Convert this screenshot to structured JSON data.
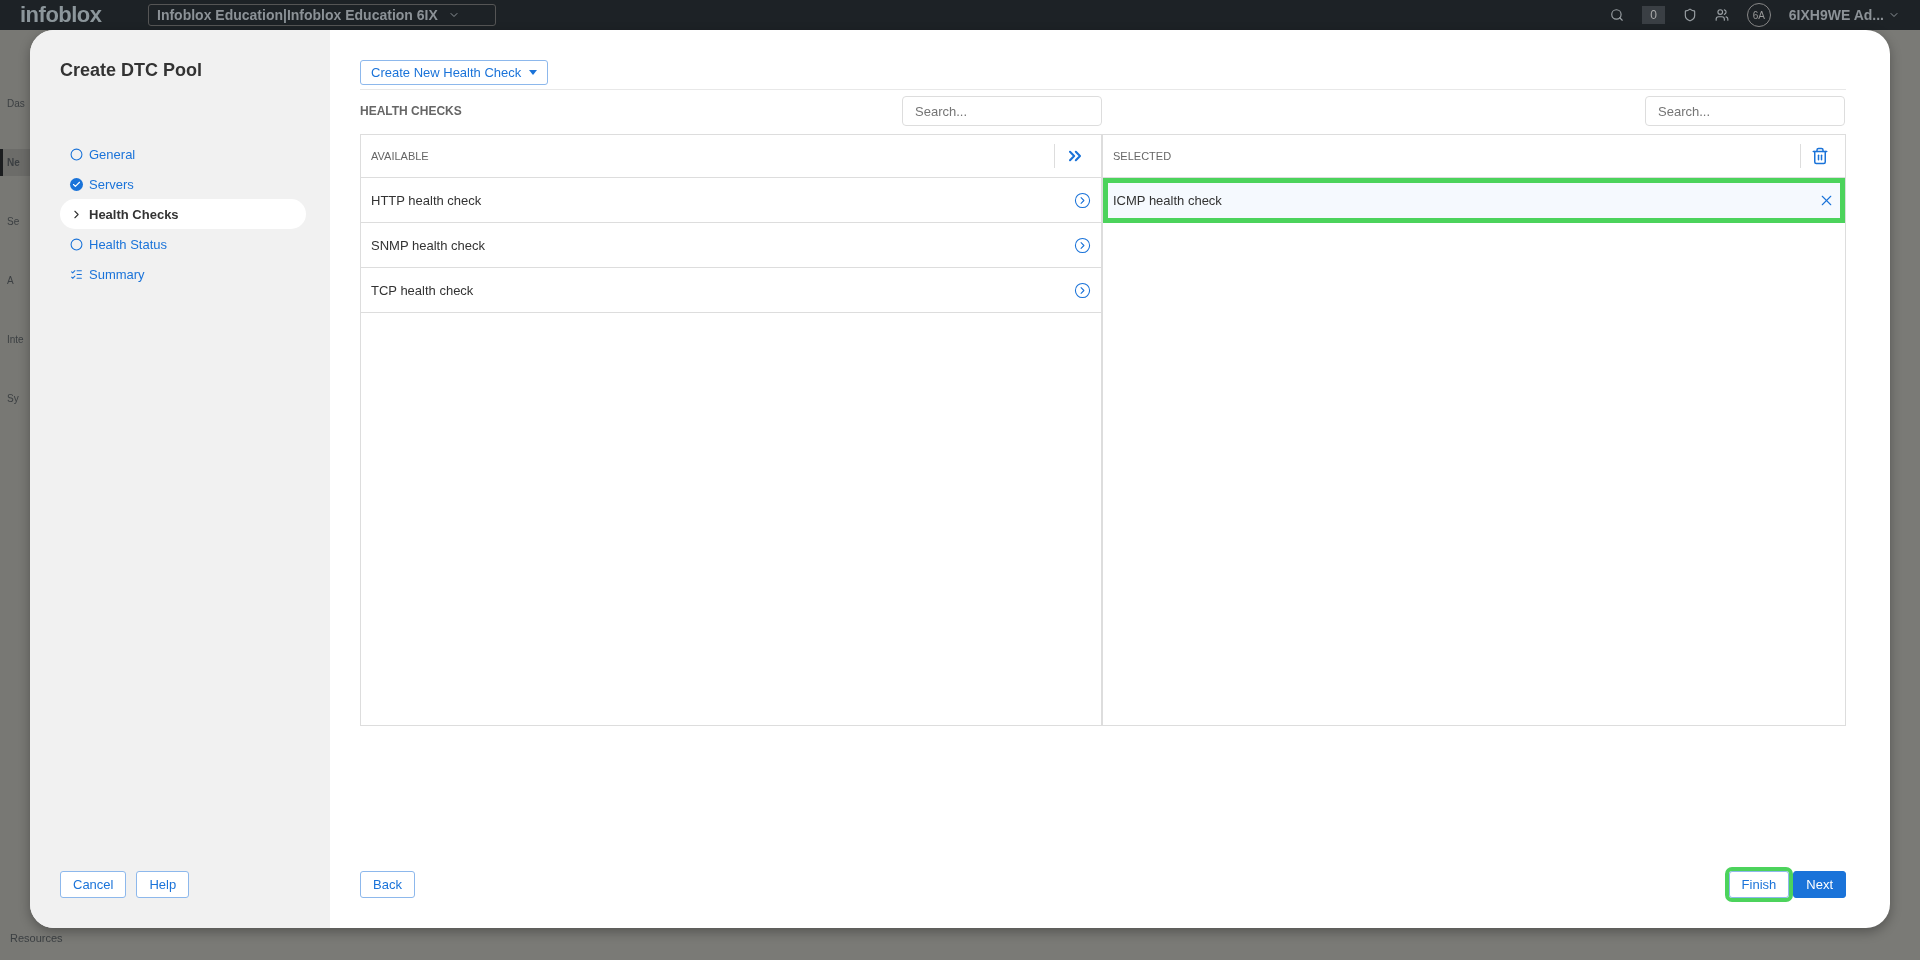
{
  "top_bar": {
    "logo": "infoblox",
    "account_selector": "Infoblox Education|Infoblox Education 6IX",
    "count": "0",
    "avatar": "6A",
    "user": "6IXH9WE Ad..."
  },
  "side_nav": {
    "items": [
      {
        "label": "Das",
        "selected": false
      },
      {
        "label": "Ne",
        "selected": true
      },
      {
        "label": "Se",
        "selected": false
      },
      {
        "label": "A",
        "selected": false
      },
      {
        "label": "Inte",
        "selected": false
      },
      {
        "label": "Sy",
        "selected": false
      }
    ],
    "footer": "Resources"
  },
  "dialog": {
    "title": "Create DTC Pool",
    "steps": [
      {
        "label": "General",
        "kind": "open",
        "selected": false
      },
      {
        "label": "Servers",
        "kind": "done",
        "selected": false
      },
      {
        "label": "Health Checks",
        "kind": "current",
        "selected": true
      },
      {
        "label": "Health Status",
        "kind": "open",
        "selected": false
      },
      {
        "label": "Summary",
        "kind": "summary",
        "selected": false
      }
    ],
    "create_button": "Create New Health Check",
    "section_title": "HEALTH CHECKS",
    "available": {
      "header": "AVAILABLE",
      "search_placeholder": "Search...",
      "items": [
        {
          "label": "HTTP health check"
        },
        {
          "label": "SNMP health check"
        },
        {
          "label": "TCP health check"
        }
      ]
    },
    "selected": {
      "header": "SELECTED",
      "search_placeholder": "Search...",
      "items": [
        {
          "label": "ICMP health check",
          "highlighted": true
        }
      ]
    },
    "left_buttons": [
      "Cancel",
      "Help"
    ],
    "back_button": "Back",
    "finish_button": {
      "label": "Finish",
      "highlighted": true
    },
    "next_button": "Next"
  }
}
